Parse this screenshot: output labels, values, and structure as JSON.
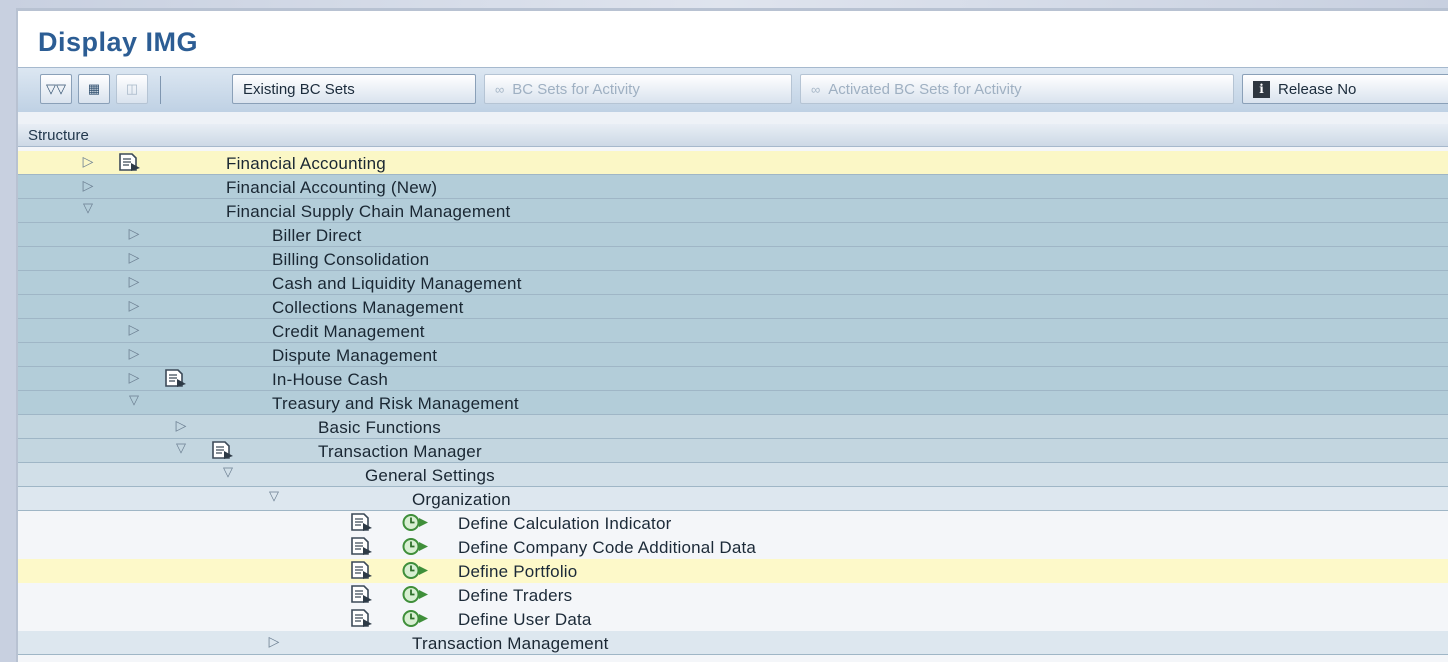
{
  "window": {
    "title": "Display IMG"
  },
  "toolbar": {
    "existing_bc_sets": "Existing BC Sets",
    "bc_sets_for_activity": "BC Sets for Activity",
    "activated_bc_sets": "Activated BC Sets for Activity",
    "release_notes": "Release No"
  },
  "tree": {
    "header": "Structure",
    "rows": [
      {
        "label": "Financial Accounting",
        "level": 0,
        "expander": "collapsed",
        "doc_icon": true,
        "exec_icon": false,
        "selected": true
      },
      {
        "label": "Financial Accounting (New)",
        "level": 0,
        "expander": "collapsed",
        "doc_icon": false,
        "exec_icon": false,
        "selected": false
      },
      {
        "label": "Financial Supply Chain Management",
        "level": 0,
        "expander": "expanded",
        "doc_icon": false,
        "exec_icon": false,
        "selected": false
      },
      {
        "label": "Biller Direct",
        "level": 1,
        "expander": "collapsed",
        "doc_icon": false,
        "exec_icon": false,
        "selected": false
      },
      {
        "label": "Billing Consolidation",
        "level": 1,
        "expander": "collapsed",
        "doc_icon": false,
        "exec_icon": false,
        "selected": false
      },
      {
        "label": "Cash and Liquidity Management",
        "level": 1,
        "expander": "collapsed",
        "doc_icon": false,
        "exec_icon": false,
        "selected": false
      },
      {
        "label": "Collections Management",
        "level": 1,
        "expander": "collapsed",
        "doc_icon": false,
        "exec_icon": false,
        "selected": false
      },
      {
        "label": "Credit Management",
        "level": 1,
        "expander": "collapsed",
        "doc_icon": false,
        "exec_icon": false,
        "selected": false
      },
      {
        "label": "Dispute Management",
        "level": 1,
        "expander": "collapsed",
        "doc_icon": false,
        "exec_icon": false,
        "selected": false
      },
      {
        "label": "In-House Cash",
        "level": 1,
        "expander": "collapsed",
        "doc_icon": true,
        "exec_icon": false,
        "selected": false
      },
      {
        "label": "Treasury and Risk Management",
        "level": 1,
        "expander": "expanded",
        "doc_icon": false,
        "exec_icon": false,
        "selected": false
      },
      {
        "label": "Basic Functions",
        "level": 2,
        "expander": "collapsed",
        "doc_icon": false,
        "exec_icon": false,
        "selected": false
      },
      {
        "label": "Transaction Manager",
        "level": 2,
        "expander": "expanded",
        "doc_icon": true,
        "exec_icon": false,
        "selected": false
      },
      {
        "label": "General Settings",
        "level": 3,
        "expander": "expanded",
        "doc_icon": false,
        "exec_icon": false,
        "selected": false
      },
      {
        "label": "Organization",
        "level": 4,
        "expander": "expanded",
        "doc_icon": false,
        "exec_icon": false,
        "selected": false
      },
      {
        "label": "Define Calculation Indicator",
        "level": 5,
        "expander": "none",
        "doc_icon": true,
        "exec_icon": true,
        "selected": false
      },
      {
        "label": "Define Company Code Additional Data",
        "level": 5,
        "expander": "none",
        "doc_icon": true,
        "exec_icon": true,
        "selected": false
      },
      {
        "label": "Define Portfolio",
        "level": 5,
        "expander": "none",
        "doc_icon": true,
        "exec_icon": true,
        "selected": true
      },
      {
        "label": "Define Traders",
        "level": 5,
        "expander": "none",
        "doc_icon": true,
        "exec_icon": true,
        "selected": false
      },
      {
        "label": "Define User Data",
        "level": 5,
        "expander": "none",
        "doc_icon": true,
        "exec_icon": true,
        "selected": false
      },
      {
        "label": "Transaction Management",
        "level": 4,
        "expander": "collapsed",
        "doc_icon": false,
        "exec_icon": false,
        "selected": false
      }
    ]
  },
  "colors": {
    "title": "#2c5d94",
    "selected_row": "#fbf7c6",
    "tree_band": "#b3cdd9",
    "exec_green": "#3f8f3a"
  }
}
